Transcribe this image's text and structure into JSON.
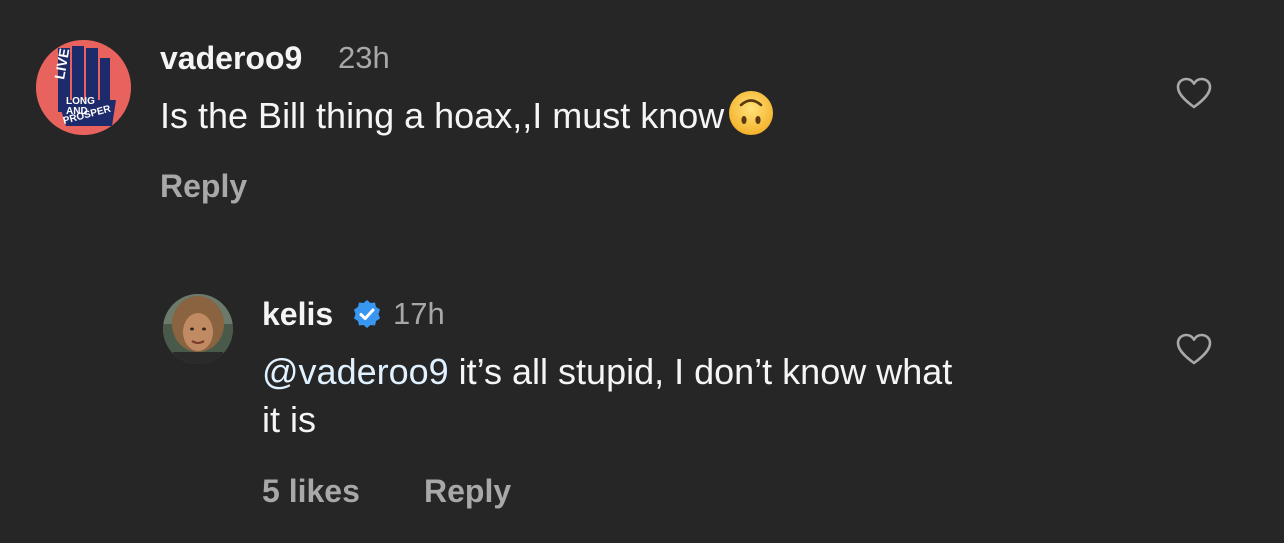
{
  "comments": [
    {
      "username": "vaderoo9",
      "time": "23h",
      "text": "Is the Bill thing a hoax,,I must know",
      "emoji": "upside-down-face",
      "reply_label": "Reply",
      "avatar_text": [
        "LIVE",
        "LONG",
        "AND",
        "PROSPER"
      ],
      "colors": {
        "avatar_bg": "#e8625e",
        "avatar_fg": "#1d2a6b"
      }
    },
    {
      "username": "kelis",
      "verified": true,
      "time": "17h",
      "mention": "@vaderoo9",
      "text_line1": " it’s all stupid, I don’t know what",
      "text_line2": "it is",
      "likes_label": "5 likes",
      "reply_label": "Reply",
      "colors": {
        "verified_badge": "#3897f0"
      }
    }
  ],
  "colors": {
    "background": "#262626",
    "primary_text": "#f5f5f5",
    "secondary_text": "#a8a8a8",
    "mention": "#e0f1ff"
  },
  "icons": [
    "heart-icon",
    "verified-badge-icon"
  ]
}
